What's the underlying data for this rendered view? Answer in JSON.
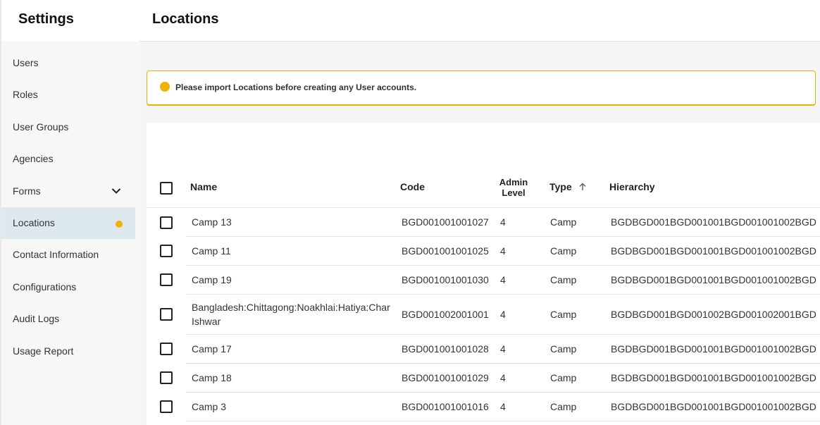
{
  "sidebar": {
    "title": "Settings",
    "items": [
      {
        "label": "Users"
      },
      {
        "label": "Roles"
      },
      {
        "label": "User Groups"
      },
      {
        "label": "Agencies"
      },
      {
        "label": "Forms"
      },
      {
        "label": "Locations"
      },
      {
        "label": "Contact Information"
      },
      {
        "label": "Configurations"
      },
      {
        "label": "Audit Logs"
      },
      {
        "label": "Usage Report"
      }
    ]
  },
  "header": {
    "title": "Locations"
  },
  "alert": {
    "text": "Please import Locations before creating any User accounts.",
    "color": "#f0b400"
  },
  "table": {
    "columns": {
      "name": "Name",
      "code": "Code",
      "admin_level_1": "Admin",
      "admin_level_2": "Level",
      "type": "Type",
      "hierarchy": "Hierarchy"
    },
    "rows": [
      {
        "name": "Camp 13",
        "code": "BGD001001001027",
        "level": "4",
        "type": "Camp",
        "hierarchy": "BGDBGD001BGD001001BGD001001002BGD"
      },
      {
        "name": "Camp 11",
        "code": "BGD001001001025",
        "level": "4",
        "type": "Camp",
        "hierarchy": "BGDBGD001BGD001001BGD001001002BGD"
      },
      {
        "name": "Camp 19",
        "code": "BGD001001001030",
        "level": "4",
        "type": "Camp",
        "hierarchy": "BGDBGD001BGD001001BGD001001002BGD"
      },
      {
        "name": "Bangladesh:Chittagong:Noakhlai:Hatiya:Char Ishwar",
        "code": "BGD001002001001",
        "level": "4",
        "type": "Camp",
        "hierarchy": "BGDBGD001BGD001002BGD001002001BGD"
      },
      {
        "name": "Camp 17",
        "code": "BGD001001001028",
        "level": "4",
        "type": "Camp",
        "hierarchy": "BGDBGD001BGD001001BGD001001002BGD"
      },
      {
        "name": "Camp 18",
        "code": "BGD001001001029",
        "level": "4",
        "type": "Camp",
        "hierarchy": "BGDBGD001BGD001001BGD001001002BGD"
      },
      {
        "name": "Camp 3",
        "code": "BGD001001001016",
        "level": "4",
        "type": "Camp",
        "hierarchy": "BGDBGD001BGD001001BGD001001002BGD"
      }
    ]
  }
}
